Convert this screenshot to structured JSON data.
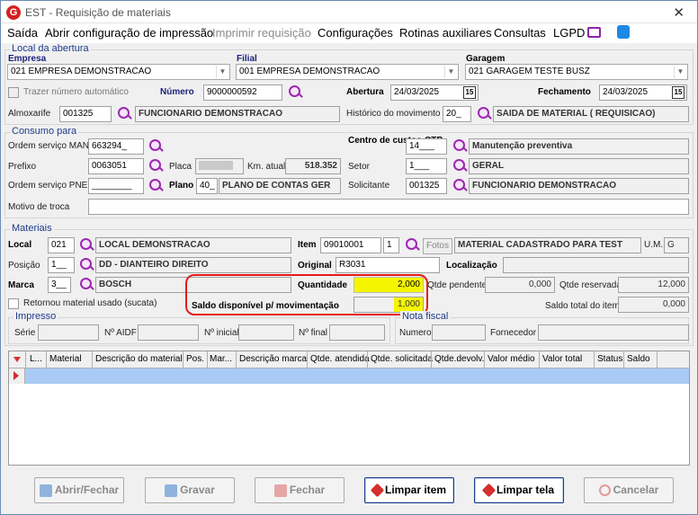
{
  "window": {
    "title": "EST - Requisição de materiais",
    "app_icon": "G",
    "close": "✕"
  },
  "menu": [
    {
      "label": "Saída",
      "enabled": true
    },
    {
      "label": "Abrir configuração de impressão",
      "enabled": true
    },
    {
      "label": "Imprimir requisição",
      "enabled": false
    },
    {
      "label": "Configurações",
      "enabled": true
    },
    {
      "label": "Rotinas auxiliares",
      "enabled": true
    },
    {
      "label": "Consultas",
      "enabled": true
    },
    {
      "label": "LGPD",
      "enabled": true
    }
  ],
  "local_abertura": {
    "title": "Local da abertura",
    "empresa_label": "Empresa",
    "empresa_value": "021 EMPRESA DEMONSTRACAO",
    "filial_label": "Filial",
    "filial_value": "001 EMPRESA DEMONSTRACAO",
    "garagem_label": "Garagem",
    "garagem_value": "021 GARAGEM TESTE BUSZ",
    "trazer_label": "Trazer número automático",
    "numero_label": "Número",
    "numero_value": "9000000592",
    "abertura_label": "Abertura",
    "abertura_value": "24/03/2025",
    "fechamento_label": "Fechamento",
    "fechamento_value": "24/03/2025",
    "almoxarife_label": "Almoxarife",
    "almoxarife_code": "001325",
    "almoxarife_name": "FUNCIONARIO DEMONSTRACAO",
    "historico_label": "Histórico do movimento",
    "historico_code": "20_",
    "historico_name": "SAIDA DE MATERIAL ( REQUISICAO)"
  },
  "consumo": {
    "title": "Consumo para",
    "os_man_label": "Ordem serviço MAN",
    "os_man_value": "663294_",
    "prefixo_label": "Prefixo",
    "prefixo_value": "0063051",
    "placa_label": "Placa",
    "km_label": "Km. atual",
    "km_value": "518.352",
    "os_pne_label": "Ordem serviço PNE",
    "os_pne_value": "________",
    "plano_label": "Plano",
    "plano_code": "40_",
    "plano_name": "PLANO DE CONTAS GER",
    "motivo_label": "Motivo de troca",
    "centro_label": "Centro de custos-CTB",
    "centro_code": "14___",
    "centro_name": "Manutenção preventiva",
    "setor_label": "Setor",
    "setor_code": "1___",
    "setor_name": "GERAL",
    "solicitante_label": "Solicitante",
    "solicitante_code": "001325",
    "solicitante_name": "FUNCIONARIO DEMONSTRACAO"
  },
  "materiais": {
    "title": "Materiais",
    "local_label": "Local",
    "local_code": "021",
    "local_name": "LOCAL DEMONSTRACAO",
    "item_label": "Item",
    "item_code": "09010001",
    "item_seq": "1",
    "fotos_label": "Fotos",
    "item_name": "MATERIAL CADASTRADO PARA TEST",
    "um_label": "U.M.",
    "um_value": "G",
    "posicao_label": "Posição",
    "posicao_code": "1__",
    "posicao_name": "DD - DIANTEIRO DIREITO",
    "original_label": "Original",
    "original_value": "R3031",
    "localizacao_label": "Localização",
    "marca_label": "Marca",
    "marca_code": "3__",
    "marca_name": "BOSCH",
    "quantidade_label": "Quantidade",
    "quantidade_value": "2,000",
    "qtde_pendente_label": "Qtde pendente",
    "qtde_pendente_value": "0,000",
    "qtde_reservada_label": "Qtde reservada",
    "qtde_reservada_value": "12,000",
    "saldo_disp_label": "Saldo disponível p/ movimentação",
    "saldo_disp_value": "1,000",
    "saldo_total_label": "Saldo total do item",
    "saldo_total_value": "0,000",
    "retornou_label": "Retornou material usado (sucata)"
  },
  "impresso": {
    "title": "Impresso",
    "serie_label": "Série",
    "aidf_label": "Nº AIDF",
    "inicial_label": "Nº inicial",
    "final_label": "Nº final"
  },
  "nota": {
    "title": "Nota fiscal",
    "numero_label": "Numero",
    "fornecedor_label": "Fornecedor"
  },
  "grid": {
    "columns": [
      "L...",
      "Material",
      "Descrição do material",
      "Pos.",
      "Mar...",
      "Descrição marca",
      "Qtde. atendida",
      "Qtde. solicitada",
      "Qtde.devolv.",
      "Valor médio",
      "Valor total",
      "Status",
      "Saldo"
    ]
  },
  "buttons": {
    "abrir": "Abrir/Fechar",
    "gravar": "Gravar",
    "fechar": "Fechar",
    "limpar_item": "Limpar item",
    "limpar_tela": "Limpar tela",
    "cancelar": "Cancelar"
  },
  "colors": {
    "accent": "#1a237e",
    "highlight": "#f5f500",
    "selection": "#aacbf5",
    "annotation": "#e41b1b"
  }
}
